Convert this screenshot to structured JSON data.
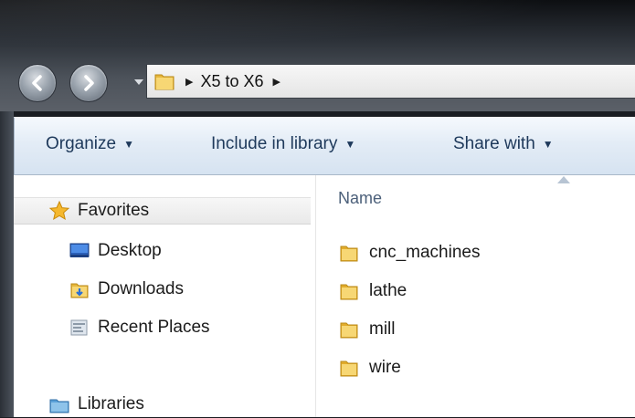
{
  "address_bar": {
    "crumbs": [
      "X5 to X6"
    ],
    "separator": "▶"
  },
  "toolbar": {
    "organize": "Organize",
    "include_in_library": "Include in library",
    "share_with": "Share with",
    "caret": "▼"
  },
  "nav_pane": {
    "favorites": "Favorites",
    "items": [
      {
        "label": "Desktop",
        "icon": "desktop-icon"
      },
      {
        "label": "Downloads",
        "icon": "downloads-folder-icon"
      },
      {
        "label": "Recent Places",
        "icon": "recent-places-icon"
      }
    ],
    "libraries": "Libraries"
  },
  "file_list": {
    "column_header": "Name",
    "items": [
      {
        "name": "cnc_machines",
        "icon": "folder-icon"
      },
      {
        "name": "lathe",
        "icon": "folder-icon"
      },
      {
        "name": "mill",
        "icon": "folder-icon"
      },
      {
        "name": "wire",
        "icon": "folder-icon"
      }
    ]
  },
  "colors": {
    "toolbar_text": "#1e395b",
    "folder_yellow": "#f2c94c",
    "column_header": "#4c607a"
  }
}
